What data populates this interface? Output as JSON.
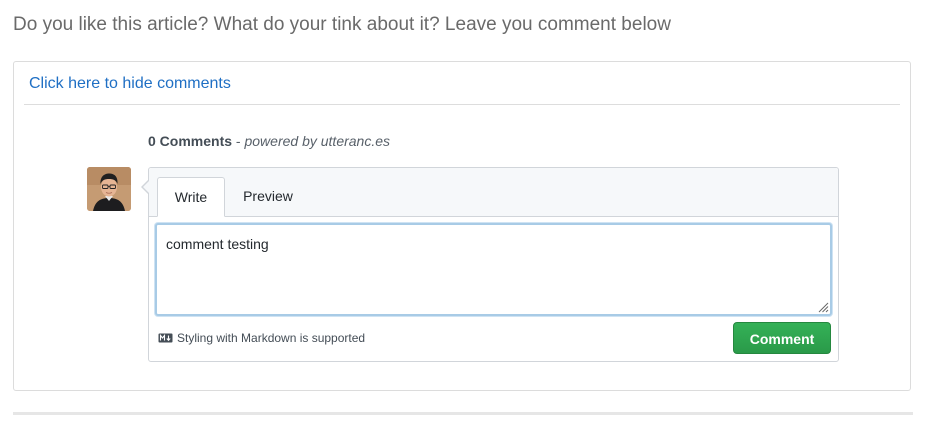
{
  "prompt": {
    "text": "Do you like this article? What do your tink about it? Leave you comment below"
  },
  "comments": {
    "toggle_label": "Click here to hide comments",
    "count_label": "0 Comments",
    "separator": " - ",
    "powered_by": "powered by utteranc.es"
  },
  "editor": {
    "tabs": [
      {
        "label": "Write",
        "active": true
      },
      {
        "label": "Preview",
        "active": false
      }
    ],
    "textarea_value": "comment testing",
    "markdown_note": "Styling with Markdown is supported",
    "submit_label": "Comment"
  },
  "icons": {
    "avatar": "user-avatar",
    "markdown": "markdown-icon",
    "resize": "resize-grip-icon"
  },
  "colors": {
    "link": "#1f6fc4",
    "submit": "#2ea44f",
    "focus": "#a8cbe6"
  }
}
